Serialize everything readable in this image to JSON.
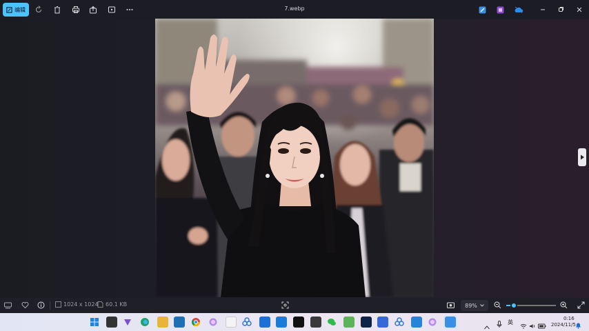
{
  "titlebar": {
    "edit_label": "编辑",
    "title": "7.webp",
    "icons": [
      "rotate-icon",
      "delete-icon",
      "print-icon",
      "share-icon",
      "slideshow-icon",
      "more-icon"
    ],
    "right_icons": [
      "photos-editor-icon",
      "clipchamp-icon",
      "onedrive-icon",
      "minimize-icon",
      "maximize-icon",
      "close-icon"
    ]
  },
  "status": {
    "dimensions": "1024 x 1024",
    "file_size": "60.1 KB",
    "zoom": "89%",
    "zoom_fraction": 0.15
  },
  "tray": {
    "ime": "英",
    "time": "0:16",
    "date": "2024/11/5"
  },
  "colors": {
    "accent": "#4cc2ff",
    "background": "#1c1c24",
    "taskbar": "#e6e6f2"
  }
}
